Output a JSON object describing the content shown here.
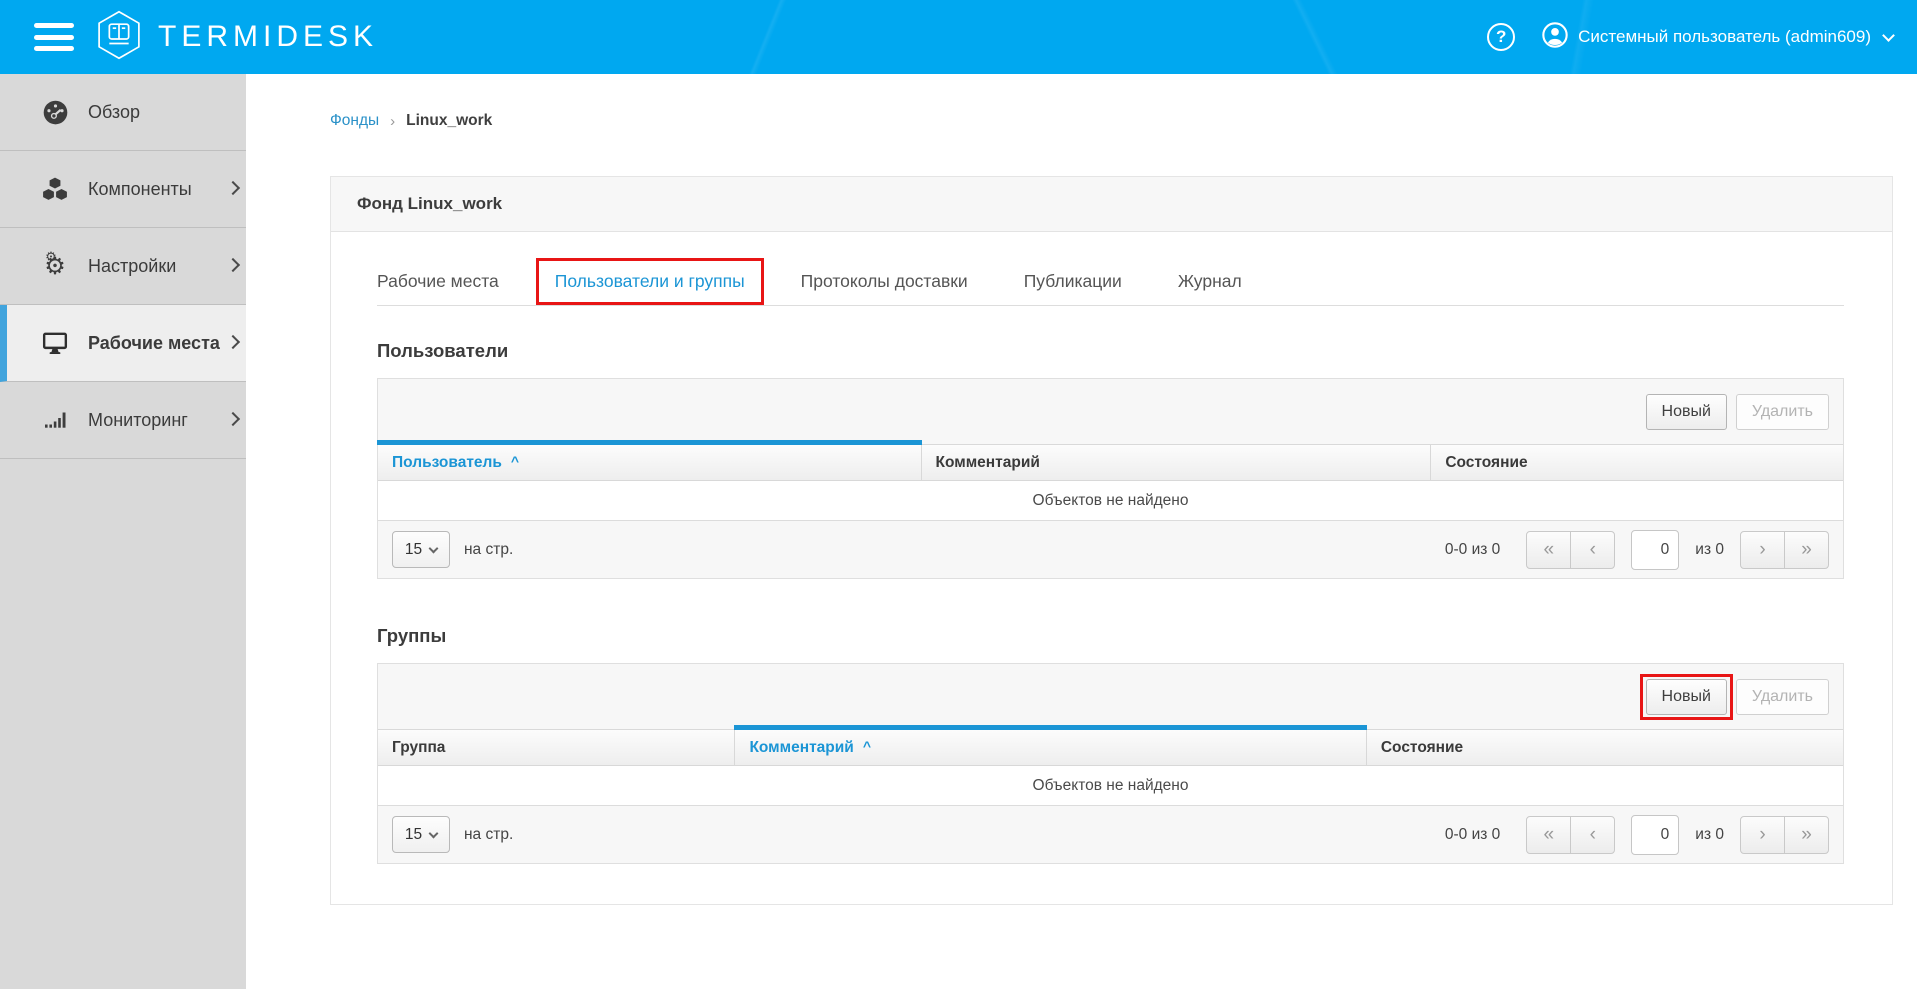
{
  "colors": {
    "header_bg": "#00a8f0",
    "accent_blue": "#1b95d5",
    "annotation_red": "#e81515",
    "active_item_bar": "#41a4dd"
  },
  "header": {
    "brand": "TERMIDESK",
    "help_glyph": "?",
    "user_label": "Системный пользователь (admin609)"
  },
  "sidebar": {
    "items": [
      {
        "label": "Обзор"
      },
      {
        "label": "Компоненты"
      },
      {
        "label": "Настройки"
      },
      {
        "label": "Рабочие места"
      },
      {
        "label": "Мониторинг"
      }
    ]
  },
  "breadcrumb": {
    "root": "Фонды",
    "separator": "›",
    "current": "Linux_work"
  },
  "panel": {
    "title": "Фонд Linux_work"
  },
  "tabs": {
    "items": [
      {
        "label": "Рабочие места"
      },
      {
        "label": "Пользователи и группы"
      },
      {
        "label": "Протоколы доставки"
      },
      {
        "label": "Публикации"
      },
      {
        "label": "Журнал"
      }
    ]
  },
  "users": {
    "heading": "Пользователи",
    "new_label": "Новый",
    "delete_label": "Удалить",
    "columns": {
      "c1": "Пользователь",
      "c2": "Комментарий",
      "c3": "Состояние"
    },
    "sort_caret": "^",
    "empty": "Объектов не найдено",
    "pager": {
      "size": "15",
      "per_page": "на стр.",
      "range": "0-0 из 0",
      "first": "«",
      "prev": "‹",
      "page": "0",
      "of": "из 0",
      "next": "›",
      "last": "»"
    }
  },
  "groups": {
    "heading": "Группы",
    "new_label": "Новый",
    "delete_label": "Удалить",
    "columns": {
      "c1": "Группа",
      "c2": "Комментарий",
      "c3": "Состояние"
    },
    "sort_caret": "^",
    "empty": "Объектов не найдено",
    "pager": {
      "size": "15",
      "per_page": "на стр.",
      "range": "0-0 из 0",
      "first": "«",
      "prev": "‹",
      "page": "0",
      "of": "из 0",
      "next": "›",
      "last": "»"
    }
  }
}
